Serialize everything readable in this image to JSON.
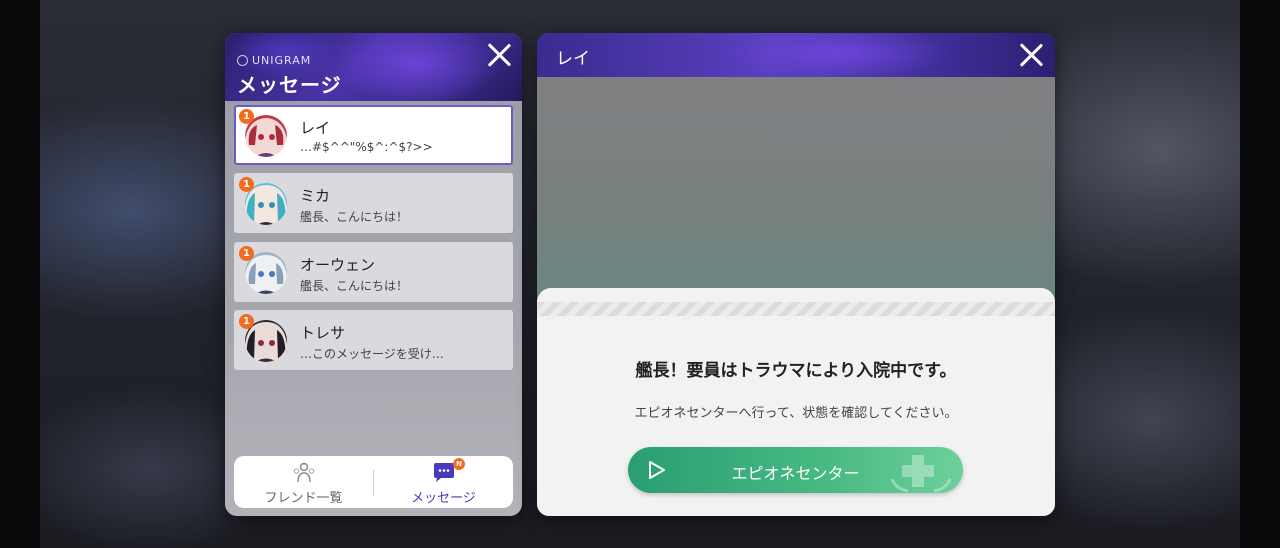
{
  "messages_panel": {
    "brand": "UNIGRAM",
    "title": "メッセージ",
    "close_icon": "close-icon",
    "conversations": [
      {
        "name": "レイ",
        "preview": "…#$^^\"%$^:^$?>>",
        "unread": "1",
        "selected": true,
        "avatar_color": "#c23a4a"
      },
      {
        "name": "ミカ",
        "preview": "艦長、こんにちは！",
        "unread": "1",
        "selected": false,
        "avatar_color": "#4ec3d6"
      },
      {
        "name": "オーウェン",
        "preview": "艦長、こんにちは！",
        "unread": "1",
        "selected": false,
        "avatar_color": "#9fb4c8"
      },
      {
        "name": "トレサ",
        "preview": "…このメッセージを受け…",
        "unread": "1",
        "selected": false,
        "avatar_color": "#2a2630"
      }
    ],
    "tabs": {
      "friends": {
        "label": "フレンド一覧",
        "icon": "friends-icon"
      },
      "messages": {
        "label": "メッセージ",
        "icon": "chat-bubble-icon",
        "badge": "N"
      }
    }
  },
  "chat_panel": {
    "title": "レイ",
    "close_icon": "close-icon",
    "notice": {
      "title": "艦長！要員はトラウマにより入院中です。",
      "text": "エピオネセンターへ行って、状態を確認してください。",
      "button_label": "エピオネセンター",
      "button_icon": "play-icon"
    }
  },
  "colors": {
    "accent": "#6b5bcb",
    "badge": "#f36b1c",
    "button_green": "#3aab78"
  }
}
